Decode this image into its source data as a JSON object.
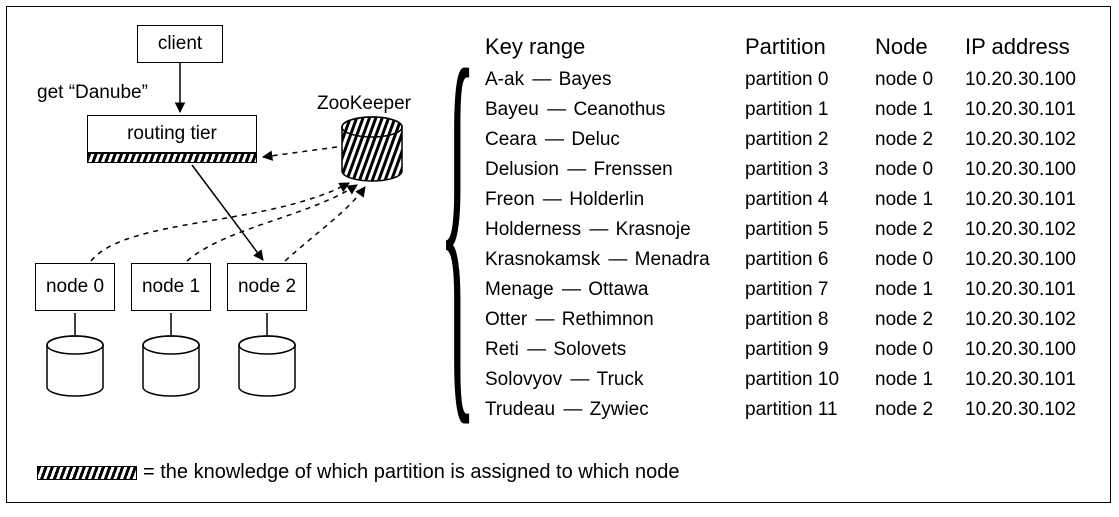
{
  "diagram": {
    "client_label": "client",
    "get_label": "get “Danube”",
    "routing_label": "routing tier",
    "zookeeper_label": "ZooKeeper",
    "nodes": [
      "node 0",
      "node 1",
      "node 2"
    ]
  },
  "table": {
    "headers": [
      "Key range",
      "Partition",
      "Node",
      "IP address"
    ],
    "rows": [
      {
        "range_from": "A-ak",
        "range_to": "Bayes",
        "partition": "partition 0",
        "node": "node 0",
        "ip": "10.20.30.100"
      },
      {
        "range_from": "Bayeu",
        "range_to": "Ceanothus",
        "partition": "partition 1",
        "node": "node 1",
        "ip": "10.20.30.101"
      },
      {
        "range_from": "Ceara",
        "range_to": "Deluc",
        "partition": "partition 2",
        "node": "node 2",
        "ip": "10.20.30.102"
      },
      {
        "range_from": "Delusion",
        "range_to": "Frenssen",
        "partition": "partition 3",
        "node": "node 0",
        "ip": "10.20.30.100"
      },
      {
        "range_from": "Freon",
        "range_to": "Holderlin",
        "partition": "partition 4",
        "node": "node 1",
        "ip": "10.20.30.101"
      },
      {
        "range_from": "Holderness",
        "range_to": "Krasnoje",
        "partition": "partition 5",
        "node": "node 2",
        "ip": "10.20.30.102"
      },
      {
        "range_from": "Krasnokamsk",
        "range_to": "Menadra",
        "partition": "partition 6",
        "node": "node 0",
        "ip": "10.20.30.100"
      },
      {
        "range_from": "Menage",
        "range_to": "Ottawa",
        "partition": "partition 7",
        "node": "node 1",
        "ip": "10.20.30.101"
      },
      {
        "range_from": "Otter",
        "range_to": "Rethimnon",
        "partition": "partition 8",
        "node": "node 2",
        "ip": "10.20.30.102"
      },
      {
        "range_from": "Reti",
        "range_to": "Solovets",
        "partition": "partition 9",
        "node": "node 0",
        "ip": "10.20.30.100"
      },
      {
        "range_from": "Solovyov",
        "range_to": "Truck",
        "partition": "partition 10",
        "node": "node 1",
        "ip": "10.20.30.101"
      },
      {
        "range_from": "Trudeau",
        "range_to": "Zywiec",
        "partition": "partition 11",
        "node": "node 2",
        "ip": "10.20.30.102"
      }
    ],
    "range_separator": " — "
  },
  "legend": {
    "text": " = the knowledge of which partition is assigned to which node"
  }
}
